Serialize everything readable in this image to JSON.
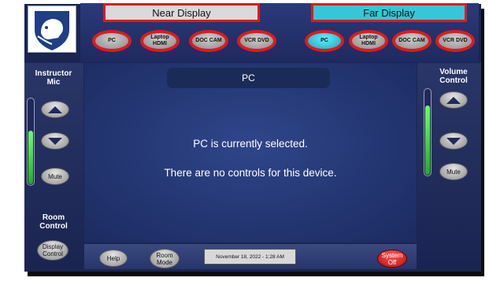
{
  "header": {
    "near_display": "Near Display",
    "far_display": "Far Display"
  },
  "near_sources": [
    {
      "label": "PC",
      "selected": false
    },
    {
      "label": "Laptop HDMI",
      "selected": false
    },
    {
      "label": "DOC CAM",
      "selected": false
    },
    {
      "label": "VCR DVD",
      "selected": false
    }
  ],
  "far_sources": [
    {
      "label": "PC",
      "selected": true
    },
    {
      "label": "Laptop HDMI",
      "selected": false
    },
    {
      "label": "DOC CAM",
      "selected": false
    },
    {
      "label": "VCR DVD",
      "selected": false
    }
  ],
  "left_panel": {
    "mic_title": "Instructor Mic",
    "mute_label": "Mute",
    "mic_level": 0.62,
    "room_control_title": "Room Control",
    "display_control_label": "Display Control"
  },
  "right_panel": {
    "volume_title": "Volume Control",
    "mute_label": "Mute",
    "volume_level": 0.8
  },
  "main": {
    "source_title": "PC",
    "message_1": "PC is currently selected.",
    "message_2": "There are no controls for this device."
  },
  "footer": {
    "help_label": "Help",
    "room_mode_label": "Room Mode",
    "datetime": "November 18, 2022  -  1:28 AM",
    "system_off_label": "System Off"
  },
  "colors": {
    "panel_bg": "#1b2550",
    "near_tab": "#dadada",
    "far_tab": "#36c6d8",
    "selected_source": "#2bc6de",
    "highlight_border": "#e01a1a",
    "system_off": "#d01818",
    "meter_green": "#3fdc3f"
  },
  "icons": [
    "penn-state-lion-logo",
    "arrow-up-icon",
    "arrow-down-icon"
  ]
}
